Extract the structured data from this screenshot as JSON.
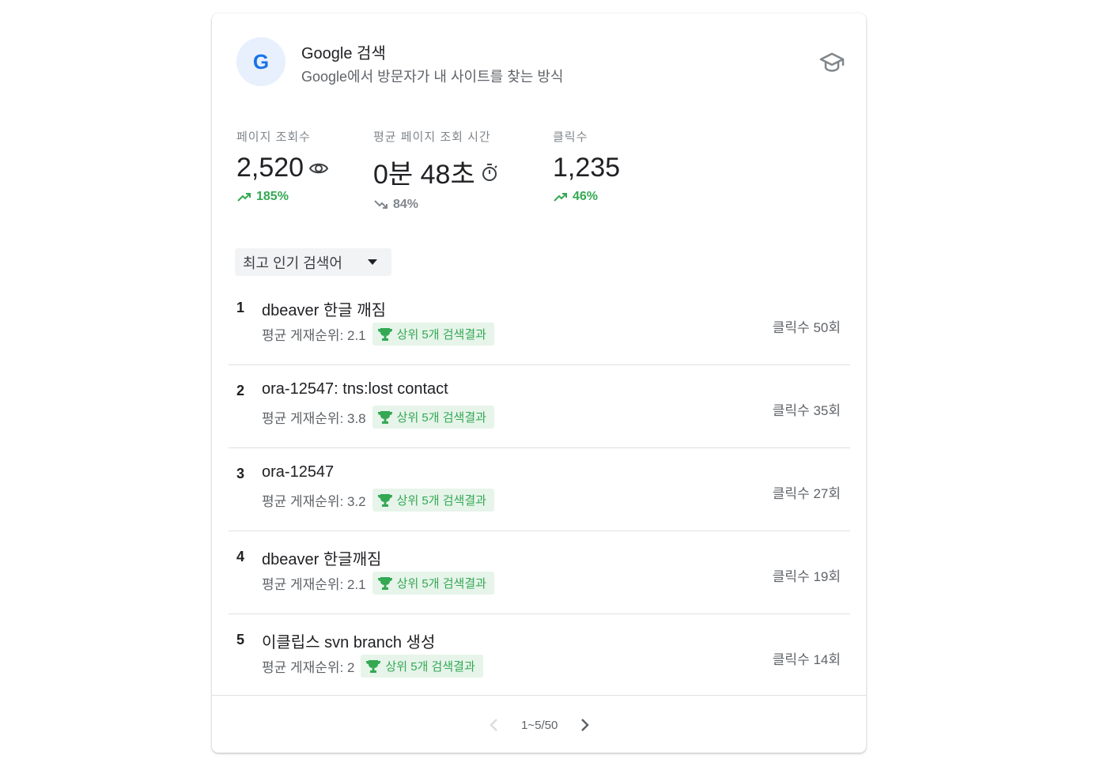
{
  "header": {
    "logo_letter": "G",
    "title": "Google 검색",
    "subtitle": "Google에서 방문자가 내 사이트를 찾는 방식"
  },
  "metrics": [
    {
      "label": "페이지 조회수",
      "value": "2,520",
      "icon": "eye-icon",
      "change": "185%",
      "trend": "up"
    },
    {
      "label": "평균 페이지 조회 시간",
      "value": "0분 48초",
      "icon": "stopwatch-icon",
      "change": "84%",
      "trend": "down"
    },
    {
      "label": "클릭수",
      "value": "1,235",
      "icon": "",
      "change": "46%",
      "trend": "up"
    }
  ],
  "dropdown": {
    "selected": "최고 인기 검색어"
  },
  "queries": [
    {
      "rank": "1",
      "query": "dbeaver 한글 깨짐",
      "avg_position": "평균 게재순위: 2.1",
      "badge": "상위 5개 검색결과",
      "clicks": "클릭수 50회"
    },
    {
      "rank": "2",
      "query": "ora-12547: tns:lost contact",
      "avg_position": "평균 게재순위: 3.8",
      "badge": "상위 5개 검색결과",
      "clicks": "클릭수 35회"
    },
    {
      "rank": "3",
      "query": "ora-12547",
      "avg_position": "평균 게재순위: 3.2",
      "badge": "상위 5개 검색결과",
      "clicks": "클릭수 27회"
    },
    {
      "rank": "4",
      "query": "dbeaver 한글깨짐",
      "avg_position": "평균 게재순위: 2.1",
      "badge": "상위 5개 검색결과",
      "clicks": "클릭수 19회"
    },
    {
      "rank": "5",
      "query": "이클립스 svn branch 생성",
      "avg_position": "평균 게재순위: 2",
      "badge": "상위 5개 검색결과",
      "clicks": "클릭수 14회"
    }
  ],
  "pagination": {
    "text": "1~5/50"
  },
  "colors": {
    "accent": "#1a73e8",
    "positive": "#34a853",
    "badge_bg": "#e6f4ea",
    "muted": "#80868b"
  }
}
